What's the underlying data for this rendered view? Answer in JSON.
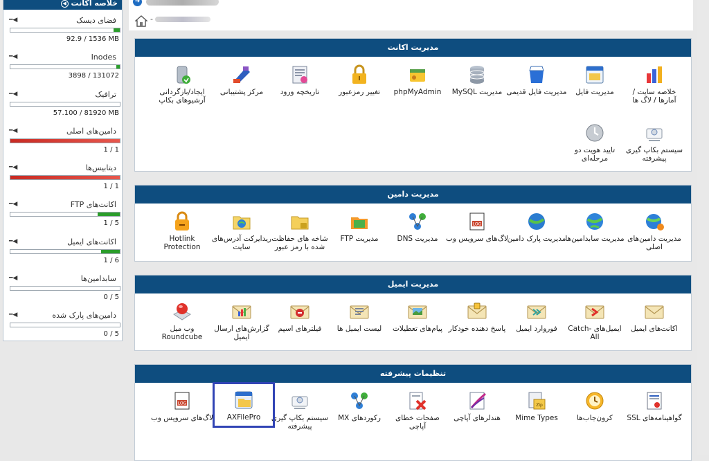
{
  "sidebar": {
    "title": "خلاصه اکانت",
    "stats": [
      {
        "label": "فضای دیسک",
        "value": "92.9 / 1536 MB",
        "fraction": 0.06,
        "color": "#2a9d2a"
      },
      {
        "label": "Inodes",
        "value": "3898 / 131072",
        "fraction": 0.03,
        "color": "#2a9d2a"
      },
      {
        "label": "ترافیک",
        "value": "57.100 / 81920 MB",
        "fraction": 0.0,
        "color": "#2a9d2a"
      },
      {
        "label": "دامین‌های اصلی",
        "value": "1 / 1",
        "fraction": 1.0,
        "color": "#d9322a"
      },
      {
        "label": "دیتابیس‌ها",
        "value": "1 / 1",
        "fraction": 1.0,
        "color": "#d9322a"
      },
      {
        "label": "اکانت‌های FTP",
        "value": "1 / 5",
        "fraction": 0.2,
        "color": "#2a9d2a"
      },
      {
        "label": "اکانت‌های ایمیل",
        "value": "1 / 6",
        "fraction": 0.17,
        "color": "#2a9d2a"
      },
      {
        "label": "سابدامین‌ها",
        "value": "0 / 5",
        "fraction": 0.0,
        "color": "#2a9d2a"
      },
      {
        "label": "دامین‌های پارک شده",
        "value": "0 / 5",
        "fraction": 0.0,
        "color": "#2a9d2a"
      }
    ]
  },
  "panels": {
    "account": {
      "title": "مدیریت اکانت",
      "items": [
        {
          "label": "خلاصه سایت / آمارها / لاگ ها",
          "icon": "stats-chart-icon"
        },
        {
          "label": "مدیریت فایل",
          "icon": "file-manager-icon"
        },
        {
          "label": "مدیریت فایل قدیمی",
          "icon": "legacy-file-manager-icon"
        },
        {
          "label": "مدیریت MySQL",
          "icon": "database-icon"
        },
        {
          "label": "phpMyAdmin",
          "icon": "phpmyadmin-icon"
        },
        {
          "label": "تغییر رمزعبور",
          "icon": "padlock-icon"
        },
        {
          "label": "تاریخچه ورود",
          "icon": "login-history-icon"
        },
        {
          "label": "مرکز پشتیبانی",
          "icon": "support-center-icon"
        },
        {
          "label": "ایجاد/بازگردانی آرشیوهای بکاپ",
          "icon": "backup-archive-icon"
        },
        {
          "label": "سیستم بکاپ گیری پیشرفته",
          "icon": "advanced-backup-icon"
        },
        {
          "label": "تایید هویت دو مرحله‌ای",
          "icon": "two-factor-icon"
        }
      ]
    },
    "domain": {
      "title": "مدیریت دامین",
      "items": [
        {
          "label": "مدیریت دامین‌های اصلی",
          "icon": "globe-gear-icon"
        },
        {
          "label": "مدیریت سابدامین‌ها",
          "icon": "globe-icon"
        },
        {
          "label": "مدیریت پارک دامین",
          "icon": "park-domain-globe-icon"
        },
        {
          "label": "لاگ‌های سرویس وب",
          "icon": "log-file-icon"
        },
        {
          "label": "مدیریت DNS",
          "icon": "dns-network-icon"
        },
        {
          "label": "مدیریت FTP",
          "icon": "ftp-folder-icon"
        },
        {
          "label": "شاخه های حفاظت شده با رمز عبور",
          "icon": "protected-folder-icon"
        },
        {
          "label": "ریدایرکت آدرس‌های سایت",
          "icon": "redirect-icon"
        },
        {
          "label": "Hotlink Protection",
          "icon": "hotlink-lock-icon"
        }
      ]
    },
    "email": {
      "title": "مدیریت ایمیل",
      "items": [
        {
          "label": "اکانت‌های ایمیل",
          "icon": "envelope-icon"
        },
        {
          "label": "ایمیل‌های Catch-All",
          "icon": "catch-all-envelope-icon"
        },
        {
          "label": "فوروارد ایمیل",
          "icon": "forward-envelope-icon"
        },
        {
          "label": "پاسخ دهنده خودکار",
          "icon": "autoresponder-icon"
        },
        {
          "label": "پیام‌های تعطیلات",
          "icon": "vacation-message-icon"
        },
        {
          "label": "لیست ایمیل ها",
          "icon": "mailing-list-icon"
        },
        {
          "label": "فیلترهای اسپم",
          "icon": "spam-filter-icon"
        },
        {
          "label": "گزارش‌های ارسال ایمیل",
          "icon": "delivery-report-icon"
        },
        {
          "label": "وب میل Roundcube",
          "icon": "roundcube-icon"
        }
      ]
    },
    "advanced": {
      "title": "تنظیمات پیشرفته",
      "items": [
        {
          "label": "گواهینامه‌های SSL",
          "icon": "ssl-certificate-icon"
        },
        {
          "label": "کرون‌جاب‌ها",
          "icon": "clock-icon"
        },
        {
          "label": "Mime Types",
          "icon": "mime-types-icon"
        },
        {
          "label": "هندلرهای آپاچی",
          "icon": "apache-handler-icon"
        },
        {
          "label": "صفحات خطای آپاچی",
          "icon": "error-page-icon"
        },
        {
          "label": "رکوردهای MX",
          "icon": "mx-records-icon"
        },
        {
          "label": "سیستم بکاپ گیری پیشرفته",
          "icon": "advanced-backup-icon"
        },
        {
          "label": "AXFilePro",
          "icon": "axfilepro-icon"
        },
        {
          "label": "لاگ‌های سرویس وب",
          "icon": "log-file-icon"
        }
      ]
    }
  }
}
